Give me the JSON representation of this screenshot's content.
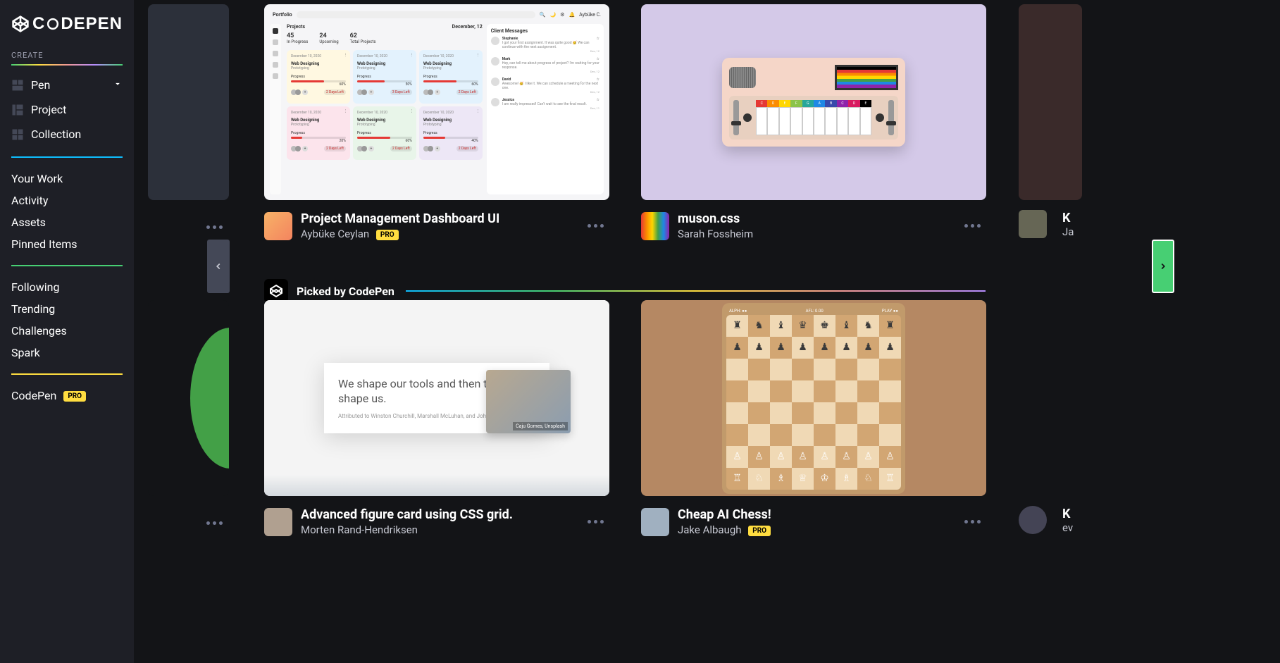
{
  "sidebar": {
    "create_label": "CREATE",
    "items": {
      "pen": "Pen",
      "project": "Project",
      "collection": "Collection"
    },
    "group1": [
      "Your Work",
      "Activity",
      "Assets",
      "Pinned Items"
    ],
    "group2": [
      "Following",
      "Trending",
      "Challenges",
      "Spark"
    ],
    "pro_link": "CodePen",
    "pro_badge": "PRO"
  },
  "picked_header": {
    "label": "Picked by CodePen"
  },
  "pens": {
    "a": {
      "title": "Project Management Dashboard UI",
      "author": "Aybüke Ceylan",
      "pro": "PRO"
    },
    "b": {
      "title": "muson.css",
      "author": "Sarah Fossheim"
    },
    "c": {
      "title": "Advanced figure card using CSS grid.",
      "author": "Morten Rand-Hendriksen"
    },
    "d": {
      "title": "Cheap AI Chess!",
      "author": "Jake Albaugh",
      "pro": "PRO"
    }
  },
  "dashboard": {
    "top_left": "Portfolio",
    "search": "Search",
    "user": "Aybüke C.",
    "projects_label": "Projects",
    "date": "December, 12",
    "messages_label": "Client Messages",
    "stats": [
      {
        "num": "45",
        "label": "In Progress"
      },
      {
        "num": "24",
        "label": "Upcoming"
      },
      {
        "num": "62",
        "label": "Total Projects"
      }
    ],
    "card_date": "December 10, 2020",
    "card_title": "Web Designing",
    "card_sub": "Prototyping",
    "card_progress": "Progress",
    "pcts": [
      "60%",
      "50%",
      "60%",
      "20%",
      "60%",
      "40%"
    ],
    "days_left": "2 Days Left",
    "days_left3": "3 Days Left",
    "messages": [
      {
        "name": "Stephanie",
        "text": "I got your first assignment. It was quite good 🥳 We can continue with the next assignment.",
        "date": "Dec, 12"
      },
      {
        "name": "Mark",
        "text": "Hey, can tell me about progress of project? I'm waiting for your response.",
        "date": "Dec, 12"
      },
      {
        "name": "David",
        "text": "Awesome! 🥳 I like it. We can schedule a meeting for the next one.",
        "date": "Dec, 12"
      },
      {
        "name": "Jessica",
        "text": "I am really impressed! Can't wait to see the final result.",
        "date": "Dec, 11"
      }
    ]
  },
  "muson": {
    "notes": [
      "C",
      "D",
      "E",
      "F",
      "G",
      "A",
      "B",
      "C",
      "D",
      "E"
    ],
    "colors": [
      "#e53935",
      "#fb8c00",
      "#ffd600",
      "#8bc34a",
      "#26a69a",
      "#1e88e5",
      "#3949ab",
      "#8e24aa",
      "#d81b60",
      "#000"
    ]
  },
  "figure": {
    "quote": "We shape our tools and then the tools shape us.",
    "attr": "Attributed to Winston Churchill, Marshall McLuhan, and John Culkin",
    "caption": "Caju Gomes, Unsplash"
  },
  "chess": {
    "top": [
      "ALPH: ●●",
      "AFL: 0.00",
      "PLAY ●●"
    ],
    "black_back": [
      "♜",
      "♞",
      "♝",
      "♛",
      "♚",
      "♝",
      "♞",
      "♜"
    ],
    "black_pawn": "♟",
    "white_back_w": [
      "♖",
      "♘",
      "♗",
      "♕",
      "♔",
      "♗",
      "♘",
      "♖"
    ],
    "white_pawn": "♙"
  },
  "partial_right": {
    "title": "K",
    "author": "Ja"
  },
  "partial_right2": {
    "title": "K",
    "author": "ev"
  }
}
